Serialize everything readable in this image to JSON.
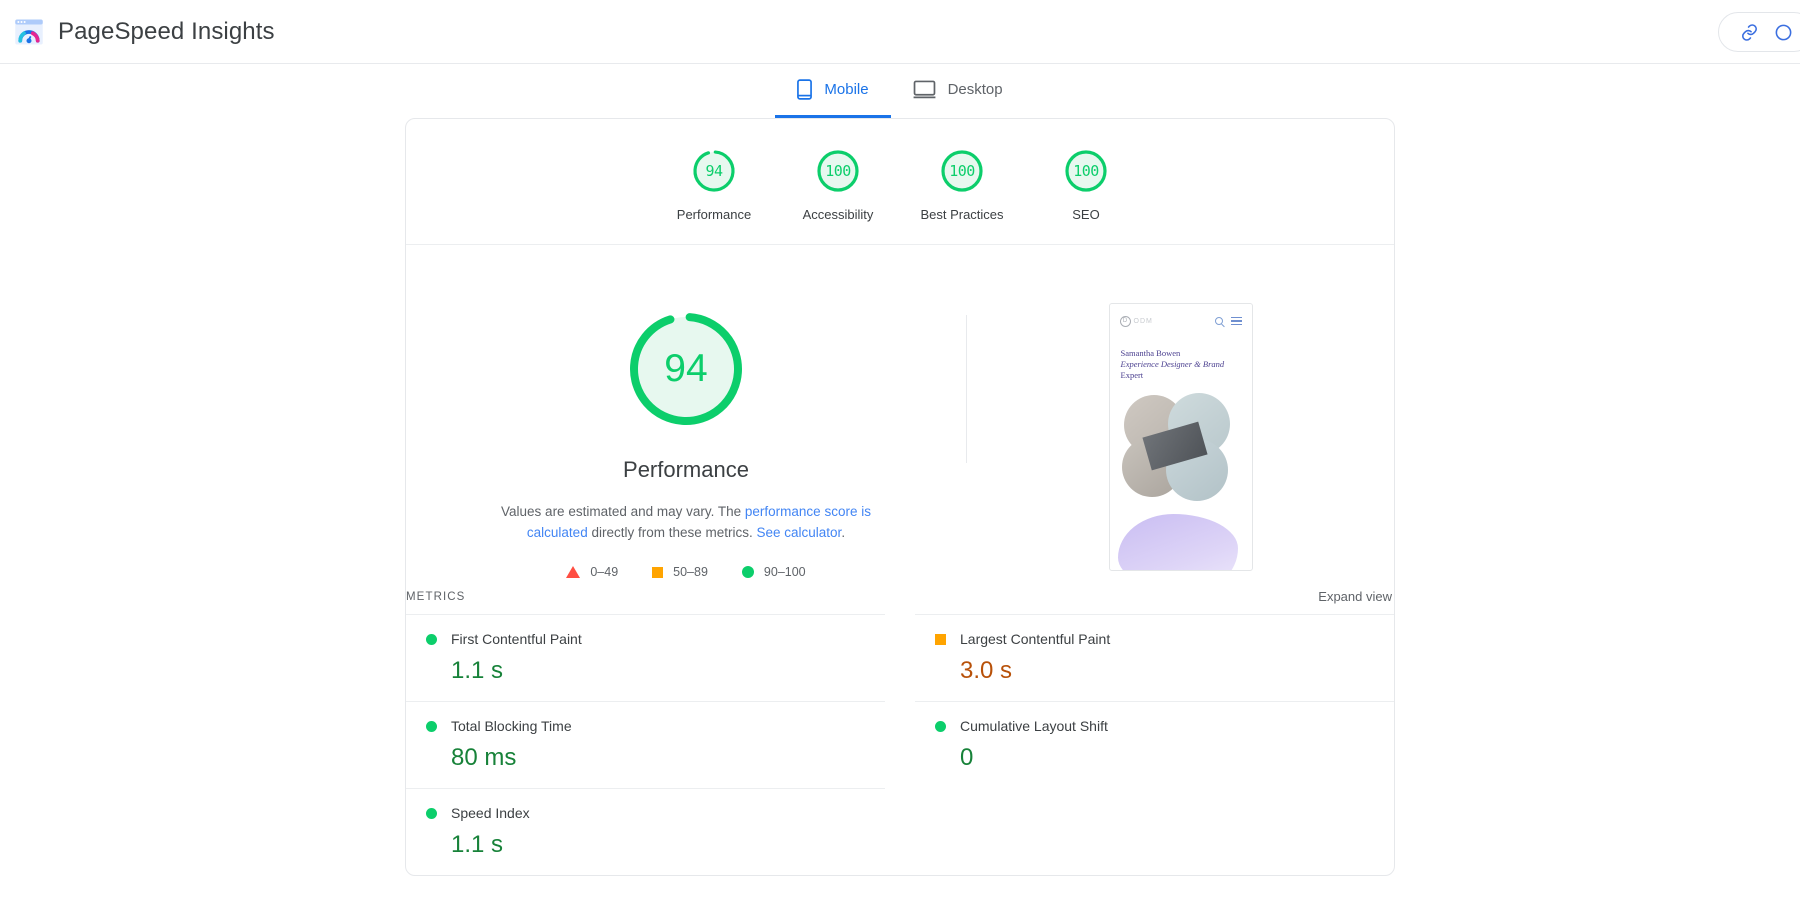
{
  "header": {
    "title": "PageSpeed Insights",
    "logo_icon": "pagespeed-logo-icon",
    "actions": [
      {
        "icon": "link-icon",
        "name": "copy-link-button"
      },
      {
        "icon": "circle-icon",
        "name": "secondary-action-button"
      }
    ]
  },
  "tabs": [
    {
      "label": "Mobile",
      "icon": "mobile-phone-icon",
      "active": true
    },
    {
      "label": "Desktop",
      "icon": "desktop-monitor-icon",
      "active": false
    }
  ],
  "category_scores": [
    {
      "label": "Performance",
      "score": "94",
      "value": 94,
      "color": "#0cce6b"
    },
    {
      "label": "Accessibility",
      "score": "100",
      "value": 100,
      "color": "#0cce6b"
    },
    {
      "label": "Best Practices",
      "score": "100",
      "value": 100,
      "color": "#0cce6b"
    },
    {
      "label": "SEO",
      "score": "100",
      "value": 100,
      "color": "#0cce6b"
    }
  ],
  "main_gauge": {
    "score": "94",
    "value": 94,
    "title": "Performance",
    "color": "#0cce6b",
    "description_prefix": "Values are estimated and may vary. The ",
    "link_1": "performance score is calculated",
    "description_middle": " directly from these metrics. ",
    "link_2": "See calculator",
    "description_suffix": "."
  },
  "legend": [
    {
      "shape": "triangle",
      "label": "0–49",
      "color": "#ff4e42"
    },
    {
      "shape": "square",
      "label": "50–89",
      "color": "#ffa400"
    },
    {
      "shape": "circle",
      "label": "90–100",
      "color": "#0cce6b"
    }
  ],
  "screenshot": {
    "site_wordmark": "ODM",
    "heading_line_1": "Samantha Bowen",
    "heading_line_2": "Experience Designer & Brand",
    "heading_line_3": "Expert"
  },
  "metrics_section": {
    "title": "METRICS",
    "expand_label": "Expand view"
  },
  "metrics": [
    {
      "name": "First Contentful Paint",
      "value": "1.1 s",
      "shape": "circle",
      "marker_color": "#0cce6b",
      "value_color": "#178239"
    },
    {
      "name": "Largest Contentful Paint",
      "value": "3.0 s",
      "shape": "square",
      "marker_color": "#ffa400",
      "value_color": "#b85109"
    },
    {
      "name": "Total Blocking Time",
      "value": "80 ms",
      "shape": "circle",
      "marker_color": "#0cce6b",
      "value_color": "#178239"
    },
    {
      "name": "Cumulative Layout Shift",
      "value": "0",
      "shape": "circle",
      "marker_color": "#0cce6b",
      "value_color": "#178239"
    },
    {
      "name": "Speed Index",
      "value": "1.1 s",
      "shape": "circle",
      "marker_color": "#0cce6b",
      "value_color": "#178239"
    }
  ]
}
